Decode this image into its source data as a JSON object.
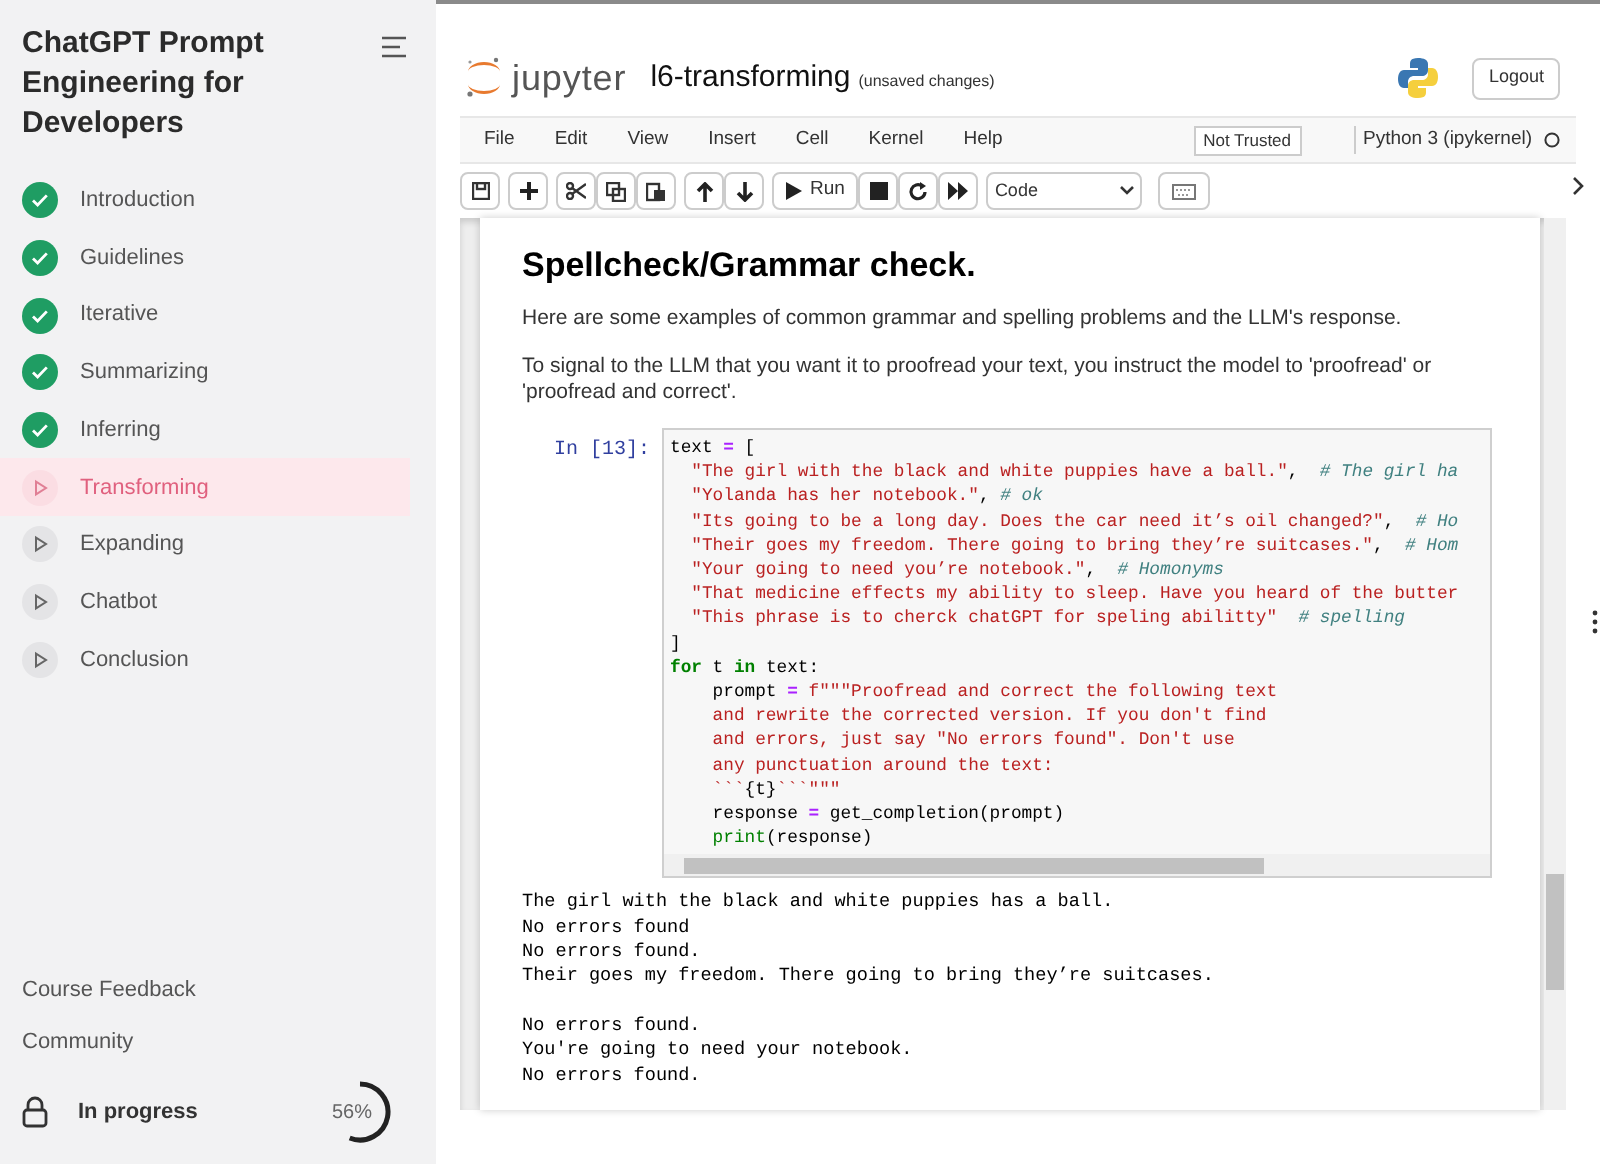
{
  "sidebar": {
    "title": "ChatGPT Prompt Engineering for Developers",
    "lessons": [
      {
        "label": "Introduction",
        "done": true,
        "selected": false
      },
      {
        "label": "Guidelines",
        "done": true,
        "selected": false
      },
      {
        "label": "Iterative",
        "done": true,
        "selected": false
      },
      {
        "label": "Summarizing",
        "done": true,
        "selected": false
      },
      {
        "label": "Inferring",
        "done": true,
        "selected": false
      },
      {
        "label": "Transforming",
        "done": false,
        "selected": true
      },
      {
        "label": "Expanding",
        "done": false,
        "selected": false
      },
      {
        "label": "Chatbot",
        "done": false,
        "selected": false
      },
      {
        "label": "Conclusion",
        "done": false,
        "selected": false
      }
    ],
    "links": [
      "Course Feedback",
      "Community"
    ],
    "progress": {
      "label": "In progress",
      "reading": "56%",
      "level": 0.56
    }
  },
  "jupyter": {
    "logo_text": "jupyter",
    "notebook_name": "l6-transforming",
    "save_status": "(unsaved changes)",
    "logout": "Logout",
    "menu": [
      "File",
      "Edit",
      "View",
      "Insert",
      "Cell",
      "Kernel",
      "Help"
    ],
    "trust": "Not Trusted",
    "kernel": "Python 3 (ipykernel)",
    "toolbar": {
      "run": "Run",
      "cell_type": "Code"
    }
  },
  "notebook": {
    "heading": "Spellcheck/Grammar check.",
    "paragraphs": [
      "Here are some examples of common grammar and spelling problems and the LLM's response.",
      "To signal to the LLM that you want it to proofread your text, you instruct the model to 'proofread' or 'proofread and correct'."
    ],
    "cell": {
      "prompt": "In [13]:",
      "lines": [
        [
          {
            "kind": "name",
            "text": "text "
          },
          {
            "kind": "op",
            "text": "="
          },
          {
            "kind": "name",
            "text": " ["
          }
        ],
        [
          {
            "kind": "str",
            "text": "  \"The girl with the black and white puppies have a ball.\""
          },
          {
            "kind": "name",
            "text": ",  "
          },
          {
            "kind": "comment",
            "text": "# The girl ha"
          }
        ],
        [
          {
            "kind": "str",
            "text": "  \"Yolanda has her notebook.\""
          },
          {
            "kind": "name",
            "text": ", "
          },
          {
            "kind": "comment",
            "text": "# ok"
          }
        ],
        [
          {
            "kind": "str",
            "text": "  \"Its going to be a long day. Does the car need it’s oil changed?\""
          },
          {
            "kind": "name",
            "text": ",  "
          },
          {
            "kind": "comment",
            "text": "# Ho"
          }
        ],
        [
          {
            "kind": "str",
            "text": "  \"Their goes my freedom. There going to bring they’re suitcases.\""
          },
          {
            "kind": "name",
            "text": ",  "
          },
          {
            "kind": "comment",
            "text": "# Hom"
          }
        ],
        [
          {
            "kind": "str",
            "text": "  \"Your going to need you’re notebook.\""
          },
          {
            "kind": "name",
            "text": ",  "
          },
          {
            "kind": "comment",
            "text": "# Homonyms"
          }
        ],
        [
          {
            "kind": "str",
            "text": "  \"That medicine effects my ability to sleep. Have you heard of the butter"
          }
        ],
        [
          {
            "kind": "str",
            "text": "  \"This phrase is to cherck chatGPT for speling abilitty\""
          },
          {
            "kind": "comment",
            "text": "  # spelling"
          }
        ],
        [
          {
            "kind": "name",
            "text": "]"
          }
        ],
        [
          {
            "kind": "kw",
            "text": "for"
          },
          {
            "kind": "name",
            "text": " t "
          },
          {
            "kind": "kw",
            "text": "in"
          },
          {
            "kind": "name",
            "text": " text:"
          }
        ],
        [
          {
            "kind": "name",
            "text": "    prompt "
          },
          {
            "kind": "op",
            "text": "="
          },
          {
            "kind": "str",
            "text": " f\"\"\"Proofread and correct the following text"
          }
        ],
        [
          {
            "kind": "str",
            "text": "    and rewrite the corrected version. If you don't find"
          }
        ],
        [
          {
            "kind": "str",
            "text": "    and errors, just say \"No errors found\". Don't use"
          }
        ],
        [
          {
            "kind": "str",
            "text": "    any punctuation around the text:"
          }
        ],
        [
          {
            "kind": "str",
            "text": "    ```"
          },
          {
            "kind": "name",
            "text": "{t}"
          },
          {
            "kind": "str",
            "text": "```\"\"\""
          }
        ],
        [
          {
            "kind": "name",
            "text": "    response "
          },
          {
            "kind": "op",
            "text": "="
          },
          {
            "kind": "name",
            "text": " get_completion(prompt)"
          }
        ],
        [
          {
            "kind": "builtin",
            "text": "    print"
          },
          {
            "kind": "name",
            "text": "(response)"
          }
        ]
      ]
    },
    "output": [
      [
        "The girl with the black and white puppies has a ball.",
        "No errors found",
        "No errors found.",
        "Their goes my freedom. There going to bring they’re suitcases."
      ],
      [
        "No errors found.",
        "You're going to need your notebook.",
        "No errors found."
      ]
    ]
  }
}
